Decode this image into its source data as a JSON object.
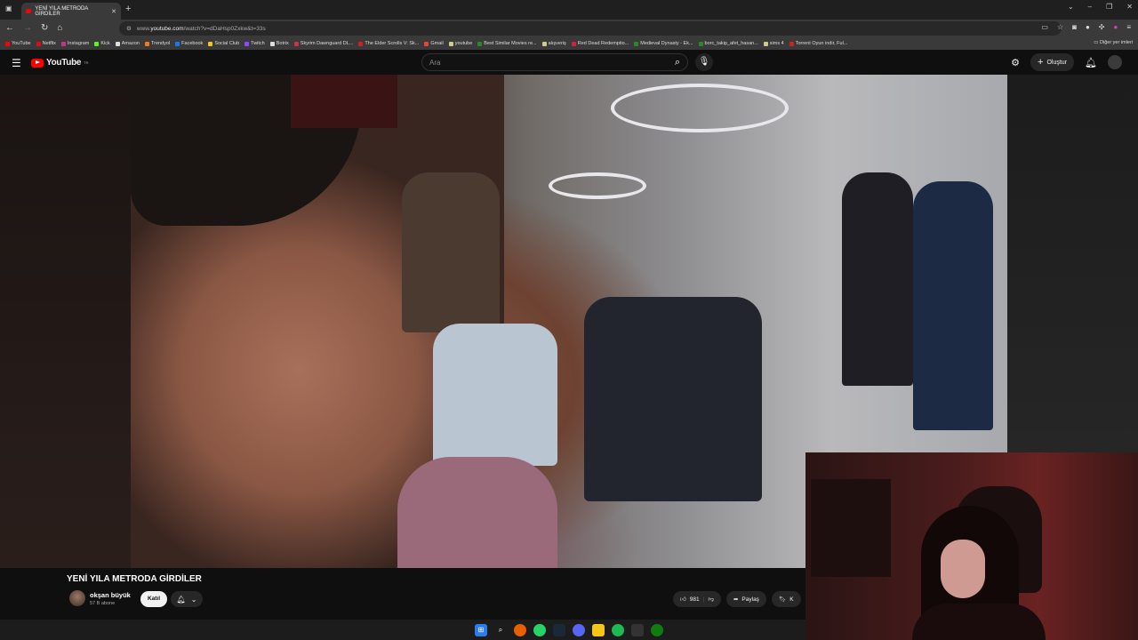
{
  "browser": {
    "tab_title": "YENİ YILA METRODA GİRDİLER",
    "url_prefix": "www.",
    "url_domain": "youtube.com",
    "url_path": "/watch?v=dDaHsp0Zxkw&t=33s",
    "bookmarks": [
      {
        "label": "YouTube",
        "color": "#ff0000"
      },
      {
        "label": "Netflix",
        "color": "#e50914"
      },
      {
        "label": "Instagram",
        "color": "#c13584"
      },
      {
        "label": "Kick",
        "color": "#53fc18"
      },
      {
        "label": "Amazon",
        "color": "#dddddd"
      },
      {
        "label": "Trendyol",
        "color": "#f27a1a"
      },
      {
        "label": "Facebook",
        "color": "#1877f2"
      },
      {
        "label": "Social Club",
        "color": "#f5c518"
      },
      {
        "label": "Twitch",
        "color": "#9146ff"
      },
      {
        "label": "Botrix",
        "color": "#dddddd"
      },
      {
        "label": "Skyrim Dawnguard DL...",
        "color": "#cc3344"
      },
      {
        "label": "The Elder Scrolls V: Sk...",
        "color": "#cc2222"
      },
      {
        "label": "Gmail",
        "color": "#ea4335"
      },
      {
        "label": "youtube",
        "color": "#cccc88"
      },
      {
        "label": "Best Similar Movies re...",
        "color": "#2a8a2a"
      },
      {
        "label": "alışveriş",
        "color": "#cccc88"
      },
      {
        "label": "Red Dead Redemptio...",
        "color": "#cc2244"
      },
      {
        "label": "Medieval Dynasty - Ek...",
        "color": "#2a8a2a"
      },
      {
        "label": "borc_takip_afet_hasan...",
        "color": "#2a8a2a"
      },
      {
        "label": "sims 4",
        "color": "#cccc88"
      },
      {
        "label": "Torrent Oyun indir, Ful...",
        "color": "#cc2222"
      }
    ],
    "other_bookmarks": "Diğer yer imleri"
  },
  "youtube": {
    "logo_text": "YouTube",
    "logo_region": "TR",
    "search_placeholder": "Ara",
    "create_label": "Oluştur"
  },
  "video": {
    "title": "YENİ YILA METRODA GİRDİLER",
    "channel_name": "okşan büyük",
    "subscribers": "57 B abone",
    "join_label": "Katıl",
    "like_count": "981",
    "share_label": "Paylaş",
    "save_label": "K"
  },
  "colors": {
    "yt_red": "#ff0000",
    "background": "#0f0f0f",
    "pill": "#272727"
  }
}
